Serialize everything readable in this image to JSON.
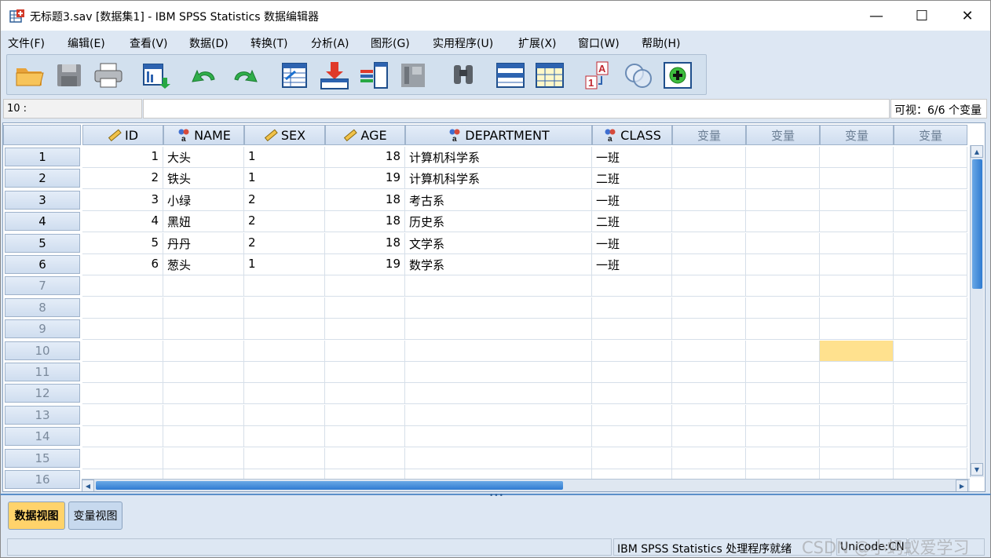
{
  "window": {
    "title": "无标题3.sav [数据集1] - IBM SPSS Statistics 数据编辑器",
    "minimize": "—",
    "maximize": "☐",
    "close": "✕"
  },
  "menu": [
    "文件(F)",
    "编辑(E)",
    "查看(V)",
    "数据(D)",
    "转换(T)",
    "分析(A)",
    "图形(G)",
    "实用程序(U)",
    "扩展(X)",
    "窗口(W)",
    "帮助(H)"
  ],
  "toolbar": [
    {
      "icon": "open-folder-icon"
    },
    {
      "icon": "save-icon"
    },
    {
      "icon": "print-icon"
    },
    {
      "icon": "recall-dialog-icon"
    },
    {
      "icon": "undo-icon"
    },
    {
      "icon": "redo-icon"
    },
    {
      "icon": "goto-case-icon"
    },
    {
      "icon": "goto-variable-icon"
    },
    {
      "icon": "variables-icon"
    },
    {
      "icon": "run-descriptives-icon"
    },
    {
      "icon": "find-icon"
    },
    {
      "icon": "insert-cases-icon"
    },
    {
      "icon": "insert-variable-icon"
    },
    {
      "icon": "split-file-icon"
    },
    {
      "icon": "select-cases-icon"
    },
    {
      "icon": "value-labels-icon"
    }
  ],
  "cell_editor": {
    "reference": "10 :",
    "value": "",
    "visible": "可视：6/6 个变量"
  },
  "grid": {
    "columns": [
      {
        "name": "ID",
        "type": "scale"
      },
      {
        "name": "NAME",
        "type": "nominal"
      },
      {
        "name": "SEX",
        "type": "scale"
      },
      {
        "name": "AGE",
        "type": "scale"
      },
      {
        "name": "DEPARTMENT",
        "type": "nominal"
      },
      {
        "name": "CLASS",
        "type": "nominal"
      }
    ],
    "empty_column_label": "变量",
    "rows": [
      [
        "1",
        "大头",
        "1",
        "18",
        "计算机科学系",
        "一班"
      ],
      [
        "2",
        "铁头",
        "1",
        "19",
        "计算机科学系",
        "二班"
      ],
      [
        "3",
        "小绿",
        "2",
        "18",
        "考古系",
        "一班"
      ],
      [
        "4",
        "黑妞",
        "2",
        "18",
        "历史系",
        "二班"
      ],
      [
        "5",
        "丹丹",
        "2",
        "18",
        "文学系",
        "一班"
      ],
      [
        "6",
        "葱头",
        "1",
        "19",
        "数学系",
        "一班"
      ]
    ],
    "row_numbers": [
      "1",
      "2",
      "3",
      "4",
      "5",
      "6",
      "7",
      "8",
      "9",
      "10",
      "11",
      "12",
      "13",
      "14",
      "15",
      "16"
    ]
  },
  "tabs": {
    "data_view": "数据视图",
    "variable_view": "变量视图"
  },
  "status": {
    "processor": "IBM SPSS Statistics 处理程序就绪",
    "unicode": "Unicode:CN",
    "watermark": "CSDN @小蚂蚁爱学习"
  }
}
